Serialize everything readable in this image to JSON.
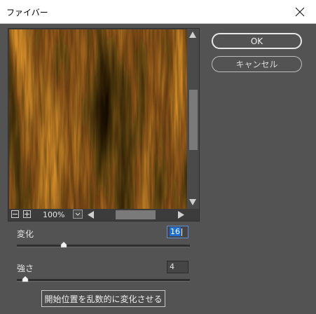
{
  "window": {
    "title": "ファイバー"
  },
  "preview": {
    "zoom": "100%"
  },
  "buttons": {
    "ok": "OK",
    "cancel": "キャンセル",
    "randomize": "開始位置を乱数的に変化させる"
  },
  "params": {
    "variance": {
      "label": "変化",
      "value": "16",
      "slider_fraction": 0.27
    },
    "strength": {
      "label": "強さ",
      "value": "4",
      "slider_fraction": 0.05
    }
  },
  "colors": {
    "fiber_dark": "#1a1204",
    "fiber_light": "#e0962c",
    "dialog_bg": "#535353"
  }
}
